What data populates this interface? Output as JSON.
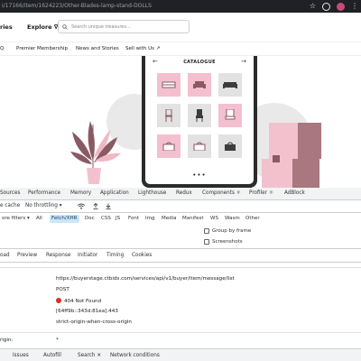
{
  "browser": {
    "url": "i/17166/item/1624223/Other-Blades-lamp-stand-DOLLS"
  },
  "site": {
    "nav": {
      "categories": "ries",
      "explore": "Explore ∇"
    },
    "search": {
      "placeholder": "Search unique treasures..."
    },
    "subnav": [
      "Q",
      "Premier Membership",
      "News and Stories",
      "Sell with Us ↗"
    ]
  },
  "hero": {
    "catalogue_title": "CATALOGUE",
    "arrow_left": "←",
    "arrow_right": "→",
    "dots": "•••",
    "colors": {
      "pink": "#f4bfcf",
      "grey": "#e2e2e2",
      "dark": "#2b2b2b",
      "box_pink": "#f3c1cd",
      "box_dark": "#a8777f"
    }
  },
  "devtools": {
    "main_tabs": [
      "Sources",
      "Performance",
      "Memory",
      "Application",
      "Lighthouse",
      "Redux",
      "Components ⚛",
      "Profiler ⚛",
      "AdBlock"
    ],
    "toolbar": {
      "disable_cache": "e cache",
      "throttling": "No throttling ▾"
    },
    "filters_label": "ore filters ▾",
    "filter_chips": [
      "All",
      "Fetch/XHR",
      "Doc",
      "CSS",
      "JS",
      "Font",
      "Img",
      "Media",
      "Manifest",
      "WS",
      "Wasm",
      "Other"
    ],
    "checkboxes": {
      "group_by_frame": "Group by frame",
      "screenshots": "Screenshots"
    },
    "request_tabs": [
      "oad",
      "Preview",
      "Response",
      "Initiator",
      "Timing",
      "Cookies"
    ],
    "request": {
      "url": "https://buyerstage.ctbids.com/services/api/v1/buyer/item/message/list",
      "method": "POST",
      "status": "404 Not Found",
      "remote": "[64ff9b::343d:81ea]:443",
      "referrer_policy": "strict-origin-when-cross-origin"
    },
    "origin_label": "rigin:",
    "origin_value": "*",
    "drawer_tabs": [
      "Issues",
      "Autofill",
      "Search ✕",
      "Network conditions"
    ],
    "status_color": "#d93025",
    "accent": "#1a73e8"
  }
}
